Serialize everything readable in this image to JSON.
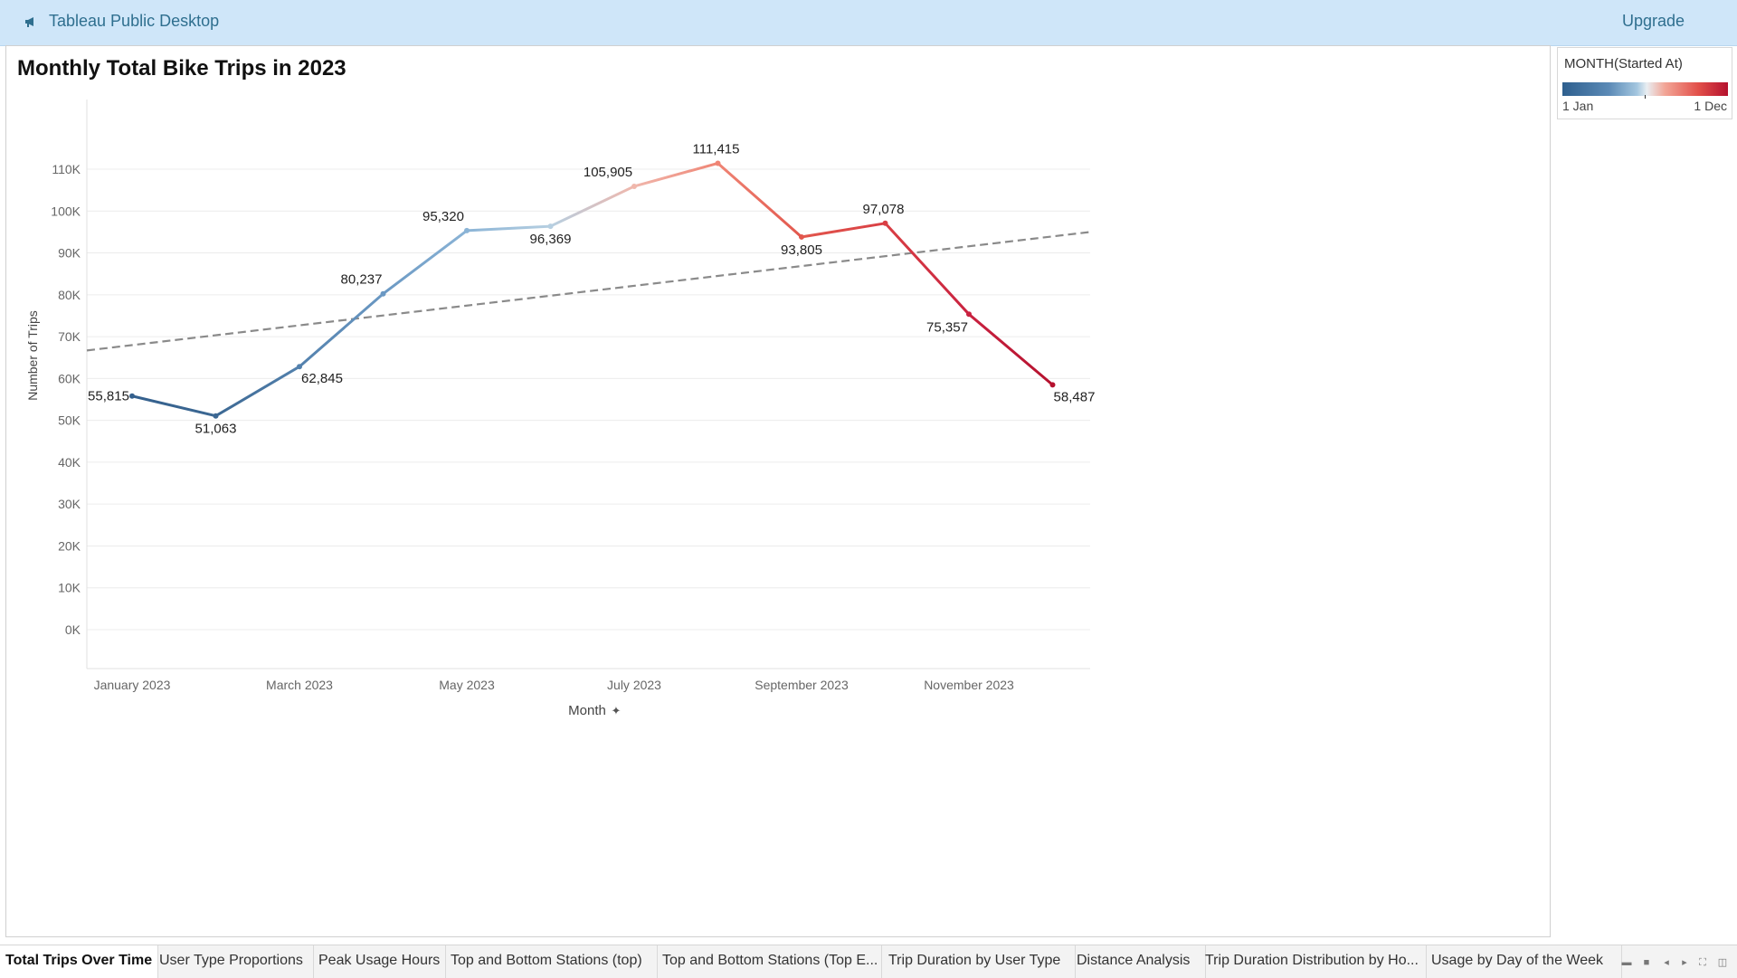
{
  "app": {
    "title": "Tableau Public Desktop",
    "upgrade_label": "Upgrade"
  },
  "sheet": {
    "title": "Monthly Total Bike Trips in 2023"
  },
  "legend": {
    "title": "MONTH(Started At)",
    "min_label": "1 Jan",
    "max_label": "1 Dec"
  },
  "tabs": [
    {
      "label": "Total Trips Over Time",
      "active": true
    },
    {
      "label": "User Type Proportions"
    },
    {
      "label": "Peak Usage Hours"
    },
    {
      "label": "Top and Bottom Stations (top)"
    },
    {
      "label": "Top and Bottom Stations (Top E..."
    },
    {
      "label": "Trip Duration by User Type"
    },
    {
      "label": "Distance Analysis"
    },
    {
      "label": "Trip Duration Distribution by Ho..."
    },
    {
      "label": "Usage by Day of the Week"
    }
  ],
  "chart_data": {
    "type": "line",
    "title": "Monthly Total Bike Trips in 2023",
    "xlabel": "Month",
    "ylabel": "Number of Trips",
    "x": [
      "January 2023",
      "February 2023",
      "March 2023",
      "April 2023",
      "May 2023",
      "June 2023",
      "July 2023",
      "August 2023",
      "September 2023",
      "October 2023",
      "November 2023",
      "December 2023"
    ],
    "x_tick_labels": [
      "January 2023",
      "March 2023",
      "May 2023",
      "July 2023",
      "September 2023",
      "November 2023"
    ],
    "values": [
      55815,
      51063,
      62845,
      80237,
      95320,
      96369,
      105905,
      111415,
      93805,
      97078,
      75357,
      58487
    ],
    "data_labels": [
      "55,815",
      "51,063",
      "62,845",
      "80,237",
      "95,320",
      "96,369",
      "105,905",
      "111,415",
      "93,805",
      "97,078",
      "75,357",
      "58,487"
    ],
    "point_colors": [
      "#34608d",
      "#3c6893",
      "#5381ad",
      "#6a98c3",
      "#8bb4d6",
      "#b6cfe1",
      "#f0b7ac",
      "#ef8474",
      "#e2574d",
      "#d93f44",
      "#c92240",
      "#b5112e"
    ],
    "y_ticks": [
      0,
      10000,
      20000,
      30000,
      40000,
      50000,
      60000,
      70000,
      80000,
      90000,
      100000,
      110000
    ],
    "y_tick_labels": [
      "0K",
      "10K",
      "20K",
      "30K",
      "40K",
      "50K",
      "60K",
      "70K",
      "80K",
      "90K",
      "100K",
      "110K"
    ],
    "ylim": [
      0,
      110000
    ],
    "trend_line": {
      "start": 66700,
      "end": 95000,
      "color": "#8a8a8a",
      "style": "dashed"
    },
    "grid": true,
    "legend": "top-right color legend (MONTH gradient)"
  }
}
